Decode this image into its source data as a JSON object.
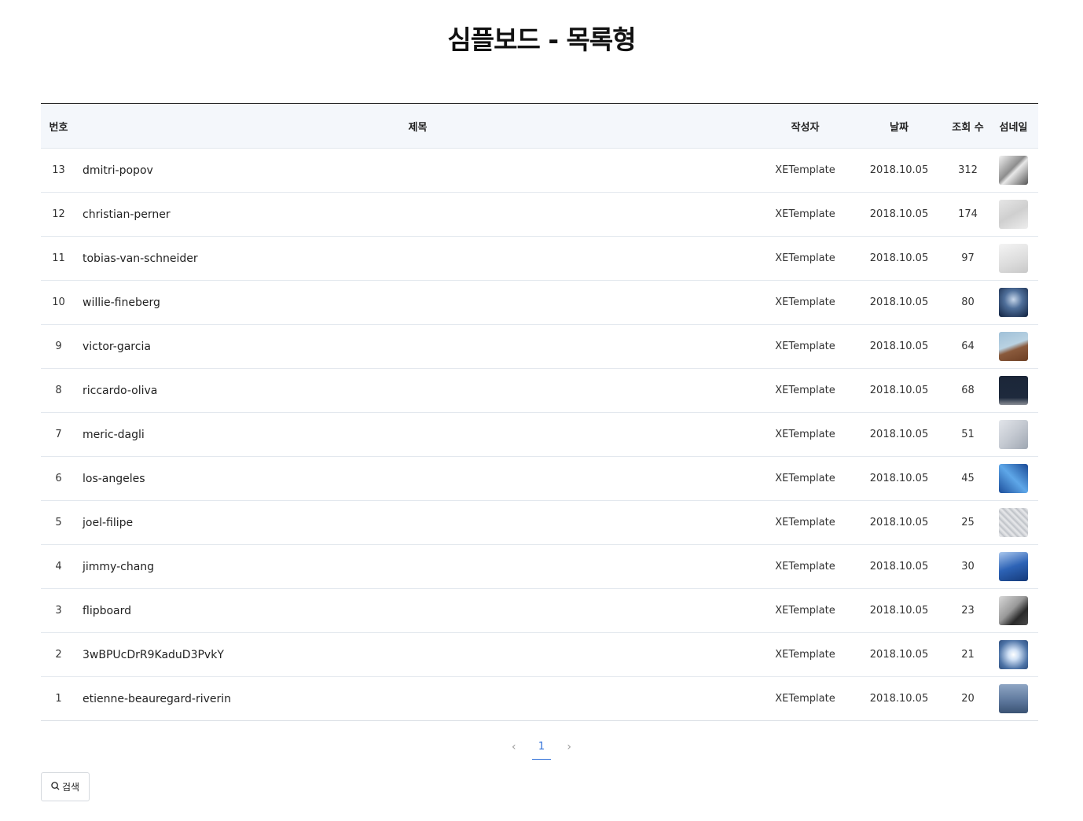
{
  "page": {
    "title": "심플보드 - 목록형"
  },
  "table": {
    "headers": {
      "no": "번호",
      "title": "제목",
      "author": "작성자",
      "date": "날짜",
      "views": "조회 수",
      "thumb": "섬네일"
    },
    "rows": [
      {
        "no": "13",
        "title": "dmitri-popov",
        "author": "XETemplate",
        "date": "2018.10.05",
        "views": "312",
        "thumb_bg": "linear-gradient(135deg,#f2f2f2 0%,#8d8d8d 45%,#e8e8e8 55%,#555 100%)"
      },
      {
        "no": "12",
        "title": "christian-perner",
        "author": "XETemplate",
        "date": "2018.10.05",
        "views": "174",
        "thumb_bg": "linear-gradient(150deg,#e6e6e6 0%,#cfcfcf 50%,#ededed 100%)"
      },
      {
        "no": "11",
        "title": "tobias-van-schneider",
        "author": "XETemplate",
        "date": "2018.10.05",
        "views": "97",
        "thumb_bg": "linear-gradient(160deg,#f4f4f4 0%,#dcdcdc 60%,#c8c8c8 100%)"
      },
      {
        "no": "10",
        "title": "willie-fineberg",
        "author": "XETemplate",
        "date": "2018.10.05",
        "views": "80",
        "thumb_bg": "radial-gradient(circle at 50% 40%,#c6d6ea 0%,#4f6f9a 40%,#10213f 100%)"
      },
      {
        "no": "9",
        "title": "victor-garcia",
        "author": "XETemplate",
        "date": "2018.10.05",
        "views": "64",
        "thumb_bg": "linear-gradient(160deg,#9fc0d8 0%,#b9d2e2 45%,#8a5a3c 60%,#6d3f24 100%)"
      },
      {
        "no": "8",
        "title": "riccardo-oliva",
        "author": "XETemplate",
        "date": "2018.10.05",
        "views": "68",
        "thumb_bg": "linear-gradient(180deg,#1b2638 0%,#1e2a3d 75%,#8b8f97 100%)"
      },
      {
        "no": "7",
        "title": "meric-dagli",
        "author": "XETemplate",
        "date": "2018.10.05",
        "views": "51",
        "thumb_bg": "linear-gradient(135deg,#e2e5ea 0%,#c4c9d1 50%,#9ea6b1 100%)"
      },
      {
        "no": "6",
        "title": "los-angeles",
        "author": "XETemplate",
        "date": "2018.10.05",
        "views": "45",
        "thumb_bg": "linear-gradient(45deg,#1c4f9c 0%,#5ea7e8 50%,#1a4a96 100%)"
      },
      {
        "no": "5",
        "title": "joel-filipe",
        "author": "XETemplate",
        "date": "2018.10.05",
        "views": "25",
        "thumb_bg": "repeating-linear-gradient(45deg,#c9ccd1 0px,#e9eaec 3px,#b5b9bf 6px)"
      },
      {
        "no": "4",
        "title": "jimmy-chang",
        "author": "XETemplate",
        "date": "2018.10.05",
        "views": "30",
        "thumb_bg": "linear-gradient(160deg,#a9c7ee 0%,#2d63b6 50%,#153a7a 100%)"
      },
      {
        "no": "3",
        "title": "flipboard",
        "author": "XETemplate",
        "date": "2018.10.05",
        "views": "23",
        "thumb_bg": "linear-gradient(135deg,#d9d9d9 0%,#9a9a9a 45%,#2a2a2a 70%,#4a4a4a 100%)"
      },
      {
        "no": "2",
        "title": "3wBPUcDrR9KaduD3PvkY",
        "author": "XETemplate",
        "date": "2018.10.05",
        "views": "21",
        "thumb_bg": "radial-gradient(circle at 50% 50%,#ffffff 0%,#cfe0f5 25%,#4d73a6 70%,#2f4f7f 100%)"
      },
      {
        "no": "1",
        "title": "etienne-beauregard-riverin",
        "author": "XETemplate",
        "date": "2018.10.05",
        "views": "20",
        "thumb_bg": "linear-gradient(180deg,#8fa6c4 0%,#5b759a 60%,#3a5273 100%)"
      }
    ]
  },
  "pagination": {
    "prev_icon": "chevron-left-icon",
    "current": "1",
    "next_icon": "chevron-right-icon"
  },
  "search": {
    "label": "검색",
    "icon": "search-icon"
  },
  "colors": {
    "accent": "#2e6fd8",
    "header_bg": "#f4f7fb",
    "border": "#e3e8ee"
  }
}
